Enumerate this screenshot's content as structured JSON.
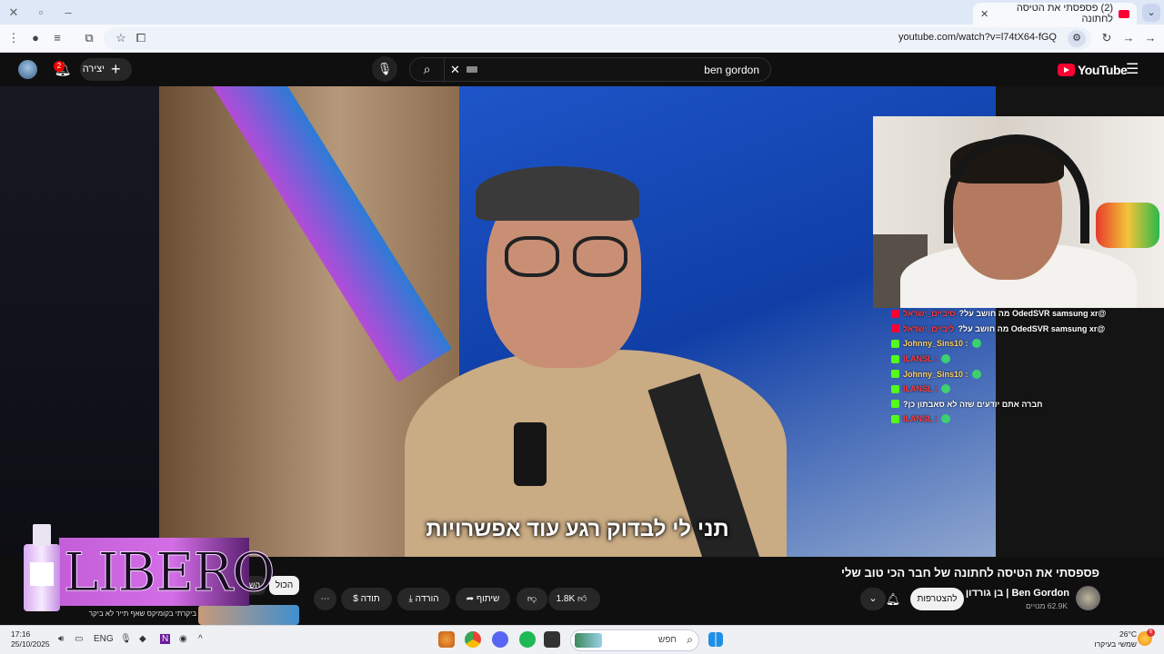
{
  "browser": {
    "tab_title": "(2) פספסתי את הטיסה לחתונה",
    "url": "youtube.com/watch?v=l74tX64-fGQ"
  },
  "header": {
    "create_label": "יצירה",
    "notifications_count": "2",
    "search_query": "ben gordon",
    "logo_text": "YouTube"
  },
  "video": {
    "subtitle": "תני לי לבדוק רגע עוד אפשרויות",
    "title": "פספסתי את הטיסה לחתונה של חבר הכי טוב שלי",
    "channel_name": "Ben Gordon | בן גורדון",
    "subscribers": "62.9K מנויים",
    "subscribe_label": "להצטרפות",
    "like_count": "1.8K",
    "share_label": "שיתוף",
    "download_label": "הורדה",
    "thanks_label": "תודה"
  },
  "chat": [
    {
      "platform": "youtube",
      "user": "סיביים_ישראל",
      "message": "@OdedSVR samsung xr מה חושב על?",
      "color": "#ff3b3b"
    },
    {
      "platform": "youtube",
      "user": "ליביים_ישראל",
      "message": "@OdedSVR samsung xr מה חושב על?",
      "color": "#ff3b3b"
    },
    {
      "platform": "kick",
      "user": "Johnny_Sins10 :",
      "message": "",
      "color": "#ffd166"
    },
    {
      "platform": "kick",
      "user": "ILANSL :",
      "message": "",
      "color": "#ff3b3b"
    },
    {
      "platform": "kick",
      "user": "Johnny_Sins10 :",
      "message": "",
      "color": "#ffd166"
    },
    {
      "platform": "kick",
      "user": "ILANSL :",
      "message": "",
      "color": "#ff3b3b"
    },
    {
      "platform": "kick",
      "user": "",
      "message": "חברה אתם יודעים שזה לא סאבתון כן?",
      "color": "#ff3b3b"
    },
    {
      "platform": "kick",
      "user": "ILANSL :",
      "message": "",
      "color": "#ff3b3b"
    }
  ],
  "filters": {
    "all_label": "הכול",
    "second_label": "הש"
  },
  "ad": {
    "brand": "LIBERO"
  },
  "recommendation": {
    "title": "ביקרתי בקומיקס שאף תייר לא ביקר"
  },
  "taskbar": {
    "time": "17:16",
    "date": "25/10/2025",
    "language": "ENG",
    "search_placeholder": "חפש",
    "weather_temp": "26°C",
    "weather_desc": "שמשי בעיקרו",
    "weather_badge": "6"
  }
}
